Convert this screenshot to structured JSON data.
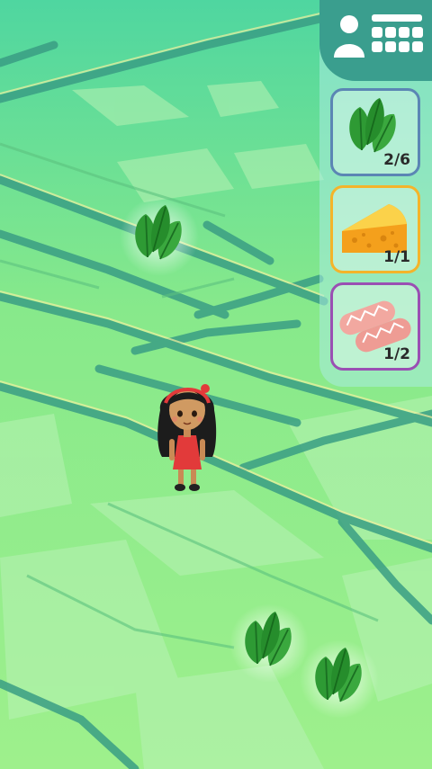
{
  "map": {
    "background_color": "#8ee88a",
    "road_color": "#3a9e84"
  },
  "header": {
    "menu_icon": "profile-grid-icon"
  },
  "inventory": [
    {
      "item": "spinach",
      "icon": "spinach-icon",
      "count": "2/6",
      "border_color": "#5b86b4"
    },
    {
      "item": "cheese",
      "icon": "cheese-icon",
      "count": "1/1",
      "border_color": "#f4b42a"
    },
    {
      "item": "salmon",
      "icon": "salmon-icon",
      "count": "1/2",
      "border_color": "#9a4fb3"
    }
  ],
  "collectibles": [
    {
      "item": "spinach",
      "icon": "spinach-icon"
    },
    {
      "item": "spinach",
      "icon": "spinach-icon"
    },
    {
      "item": "spinach",
      "icon": "spinach-icon"
    }
  ],
  "player": {
    "icon": "girl-avatar",
    "dress_color": "#e23a3a"
  }
}
